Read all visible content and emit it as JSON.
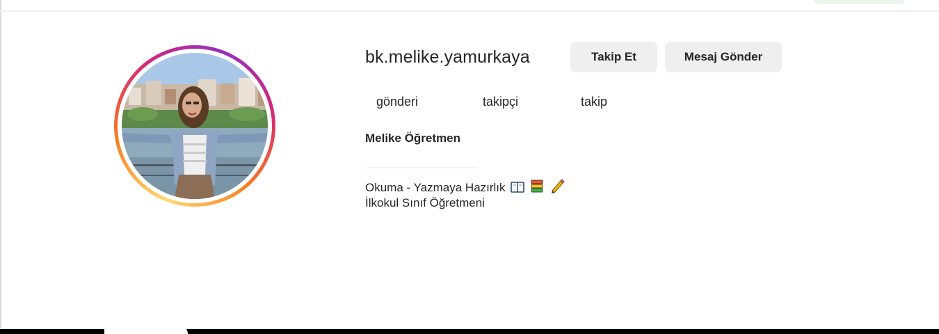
{
  "profile": {
    "username": "bk.melike.yamurkaya",
    "full_name": "Melike Öğretmen",
    "avatar_icon": "profile-photo-with-story-ring",
    "story_ring_colors": [
      "#feda75",
      "#fa7e1e",
      "#d62976",
      "#962fbf"
    ]
  },
  "actions": {
    "follow_label": "Takip Et",
    "message_label": "Mesaj Gönder"
  },
  "stats": {
    "posts_label": "gönderi",
    "followers_label": "takipçi",
    "following_label": "takip"
  },
  "bio": {
    "line1": "Okuma - Yazmaya Hazırlık",
    "line1_icons": [
      "open-book-icon",
      "books-stack-icon",
      "pencil-icon"
    ],
    "line2": "İlkokul Sınıf Öğretmeni"
  }
}
